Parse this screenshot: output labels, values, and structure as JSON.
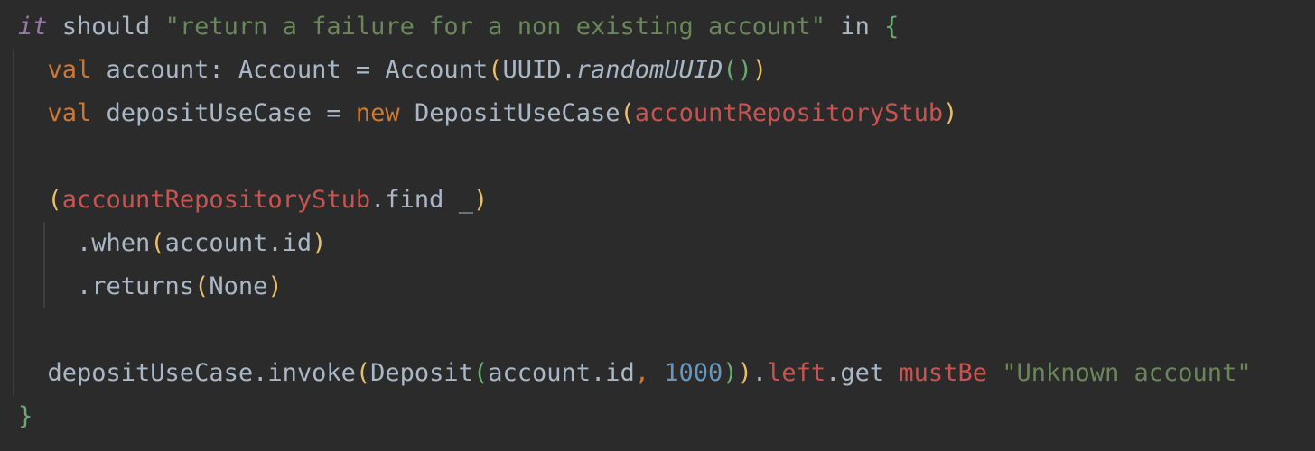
{
  "editor": {
    "language": "scala",
    "theme_colors": {
      "background": "#2b2b2b",
      "default": "#a9b7c6",
      "keyword": "#cc7832",
      "string": "#6a8759",
      "number": "#6897bb",
      "member_red": "#c75450",
      "italic_purple": "#9876aa",
      "bracket_gold": "#e8bf6a",
      "bracket_green": "#6aab73",
      "bracket_blue": "#56a8f5"
    },
    "lines": [
      {
        "tokens": [
          {
            "t": "it",
            "c": "it"
          },
          {
            "t": " should ",
            "c": ""
          },
          {
            "t": "\"return a failure for a non existing account\"",
            "c": "str"
          },
          {
            "t": " in ",
            "c": ""
          },
          {
            "t": "{",
            "c": "p2"
          }
        ]
      },
      {
        "tokens": [
          {
            "t": "  ",
            "c": ""
          },
          {
            "t": "val",
            "c": "kw"
          },
          {
            "t": " account: Account = Account",
            "c": ""
          },
          {
            "t": "(",
            "c": "p1"
          },
          {
            "t": "UUID.",
            "c": ""
          },
          {
            "t": "randomUUID",
            "c": "it-call"
          },
          {
            "t": "()",
            "c": "p2"
          },
          {
            "t": ")",
            "c": "p1"
          }
        ]
      },
      {
        "tokens": [
          {
            "t": "  ",
            "c": ""
          },
          {
            "t": "val",
            "c": "kw"
          },
          {
            "t": " depositUseCase = ",
            "c": ""
          },
          {
            "t": "new",
            "c": "kw"
          },
          {
            "t": " DepositUseCase",
            "c": ""
          },
          {
            "t": "(",
            "c": "p1"
          },
          {
            "t": "accountRepositoryStub",
            "c": "red"
          },
          {
            "t": ")",
            "c": "p1"
          }
        ]
      },
      {
        "tokens": []
      },
      {
        "tokens": [
          {
            "t": "  ",
            "c": ""
          },
          {
            "t": "(",
            "c": "p1"
          },
          {
            "t": "accountRepositoryStub",
            "c": "red"
          },
          {
            "t": ".find _",
            "c": ""
          },
          {
            "t": ")",
            "c": "p1"
          }
        ]
      },
      {
        "tokens": [
          {
            "t": "    .when",
            "c": ""
          },
          {
            "t": "(",
            "c": "p1"
          },
          {
            "t": "account.id",
            "c": ""
          },
          {
            "t": ")",
            "c": "p1"
          }
        ]
      },
      {
        "tokens": [
          {
            "t": "    .returns",
            "c": ""
          },
          {
            "t": "(",
            "c": "p1"
          },
          {
            "t": "None",
            "c": ""
          },
          {
            "t": ")",
            "c": "p1"
          }
        ]
      },
      {
        "tokens": []
      },
      {
        "tokens": [
          {
            "t": "  depositUseCase.invoke",
            "c": ""
          },
          {
            "t": "(",
            "c": "p1"
          },
          {
            "t": "Deposit",
            "c": ""
          },
          {
            "t": "(",
            "c": "p2"
          },
          {
            "t": "account.id",
            "c": ""
          },
          {
            "t": ", ",
            "c": "kw"
          },
          {
            "t": "1000",
            "c": "num"
          },
          {
            "t": ")",
            "c": "p2"
          },
          {
            "t": ")",
            "c": "p1"
          },
          {
            "t": ".",
            "c": ""
          },
          {
            "t": "left",
            "c": "red"
          },
          {
            "t": ".get ",
            "c": ""
          },
          {
            "t": "mustBe",
            "c": "red"
          },
          {
            "t": " ",
            "c": ""
          },
          {
            "t": "\"Unknown account\"",
            "c": "str"
          }
        ]
      },
      {
        "tokens": [
          {
            "t": "}",
            "c": "p2"
          }
        ]
      }
    ]
  }
}
